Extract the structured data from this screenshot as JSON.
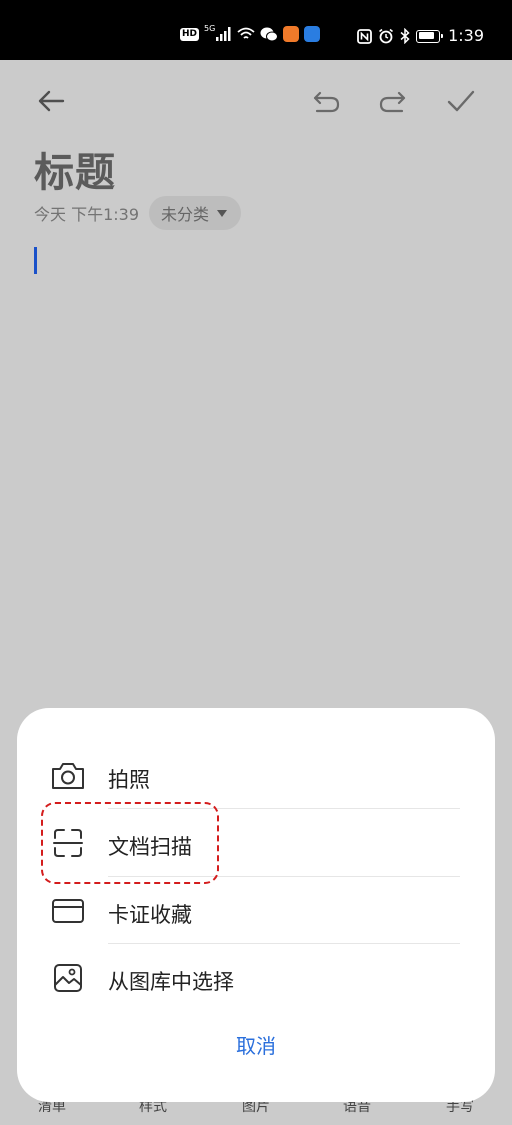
{
  "status_bar": {
    "hd_badge": "HD",
    "network": "5G",
    "time": "1:39",
    "icons": [
      "signal-icon",
      "wifi-icon",
      "wechat-icon",
      "app-icon",
      "app-icon",
      "nfc-icon",
      "alarm-icon",
      "bluetooth-icon",
      "battery-icon"
    ]
  },
  "toolbar": {
    "back": "back-arrow-icon",
    "undo": "undo-icon",
    "redo": "redo-icon",
    "confirm": "check-icon"
  },
  "note": {
    "title": "标题",
    "date": "今天 下午1:39",
    "category": "未分类"
  },
  "bottom_tabs": [
    "清单",
    "样式",
    "图片",
    "语音",
    "手写"
  ],
  "sheet": {
    "items": [
      {
        "label": "拍照",
        "icon": "camera-icon"
      },
      {
        "label": "文档扫描",
        "icon": "scan-icon"
      },
      {
        "label": "卡证收藏",
        "icon": "card-icon"
      },
      {
        "label": "从图库中选择",
        "icon": "gallery-icon"
      }
    ],
    "cancel": "取消"
  },
  "colors": {
    "accent": "#2a6fdc",
    "cursor": "#1a51c9",
    "highlight": "#d41c1c",
    "overlay": "#cbcbcb"
  }
}
